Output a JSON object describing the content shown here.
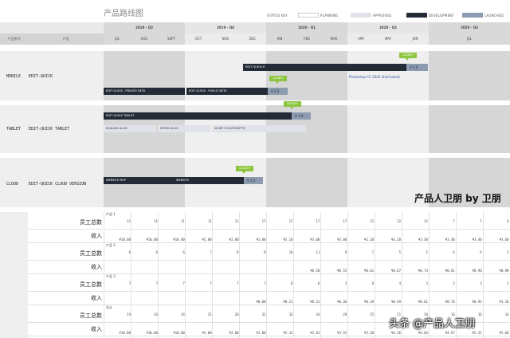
{
  "title": "产品路线图",
  "status_key": {
    "label": "STATUS KEY",
    "items": [
      {
        "label": "PLANNING",
        "color": "#ffffff"
      },
      {
        "label": "APPROVED",
        "color": "#dfe3e8"
      },
      {
        "label": "DEVELOPMENT",
        "color": "#232b36"
      },
      {
        "label": "LAUNCHED",
        "color": "#8c9bb0"
      }
    ]
  },
  "header": {
    "col1": "产品系列",
    "col2": "产品",
    "quarters": [
      "2019 - Q3",
      "2019 - Q4",
      "2020 - Q1",
      "2020 - Q2",
      "2020 - Q3"
    ],
    "months": [
      "JUL",
      "AUG",
      "SEPT",
      "OCT",
      "NOV",
      "DEC",
      "JAN",
      "FEB",
      "MAR",
      "APR",
      "MAY",
      "JUN",
      "JUL"
    ]
  },
  "lanes": [
    {
      "series": "MOBILE",
      "product": "EDIT-QUICK",
      "bars": [
        {
          "label": "EDIT QUICK 8"
        },
        {
          "label": "EDIT QUICK - PRIVATE BETA"
        },
        {
          "label": "EDIT QUICK - PUBLIC BETA"
        }
      ],
      "versions": [
        "V 3.0",
        "V 2.0"
      ],
      "launch": "LAUNCH",
      "note": "Photoshop CC 2020 (Estimated)"
    },
    {
      "series": "TABLET",
      "product": "EDIT-QUICK TABLET",
      "bars": [
        {
          "label": "EDIT QUICK TABLET"
        },
        {
          "label": "SCALING ALGO"
        },
        {
          "label": "SPEED ALGO"
        },
        {
          "label": "16 BIT COLOR DEPTH"
        }
      ],
      "versions": [
        "V 1.0"
      ],
      "launch": "LAUNCH"
    },
    {
      "series": "CLOUD",
      "product": "EDIT-QUICK CLOUD VERSION",
      "bars": [
        {
          "label": "WEBSITE MVP"
        },
        {
          "label": "WEBSITE"
        }
      ],
      "versions": [
        "V 1.0"
      ],
      "launch": "LAUNCH"
    }
  ],
  "watermark_top": "产品人卫朋 by 卫朋",
  "watermark_bottom": "头条 @产品人卫朋",
  "table": {
    "groups": [
      {
        "name": "产品 1",
        "rows": [
          {
            "label": "员工总数",
            "values": [
              "11",
              "11",
              "11",
              "11",
              "11",
              "17",
              "17",
              "17",
              "17",
              "12",
              "12",
              "12",
              "7",
              "7",
              "6"
            ]
          },
          {
            "label": "收入",
            "values": [
              "¥10.00",
              "¥10.00",
              "¥10.00",
              "¥2.00",
              "¥2.00",
              "¥1.00",
              "¥2.10",
              "¥3.00",
              "¥3.00",
              "¥2.20",
              "¥3.20",
              "¥3.30",
              "¥3.40",
              "¥3.40",
              "¥3.60"
            ]
          }
        ]
      },
      {
        "name": "产品 2",
        "rows": [
          {
            "label": "员工总数",
            "values": [
              "6",
              "6",
              "6",
              "7",
              "8",
              "8",
              "10",
              "11",
              "9",
              "7",
              "5",
              "5",
              "6",
              "6",
              "5"
            ]
          },
          {
            "label": "收入",
            "values": [
              "",
              "",
              "",
              "",
              "",
              "",
              "",
              "¥0.50",
              "¥0.55",
              "¥0.61",
              "¥0.67",
              "¥0.73",
              "¥0.81",
              "¥0.90",
              "¥0.98"
            ]
          }
        ]
      },
      {
        "name": "产品 3",
        "rows": [
          {
            "label": "员工总数",
            "values": [
              "7",
              "7",
              "7",
              "7",
              "7",
              "7",
              "6",
              "6",
              "3",
              "6",
              "4",
              "3",
              "3",
              "3",
              "3"
            ]
          },
          {
            "label": "收入",
            "values": [
              "",
              "",
              "",
              "",
              "",
              "¥0.00",
              "¥0.21",
              "¥0.31",
              "¥0.36",
              "¥0.39",
              "¥0.49",
              "¥0.61",
              "¥0.76",
              "¥0.95",
              "¥1.10"
            ]
          }
        ]
      },
      {
        "name": "总计",
        "rows": [
          {
            "label": "员工总数",
            "values": [
              "24",
              "24",
              "24",
              "25",
              "26",
              "32",
              "33",
              "34",
              "29",
              "25",
              "21",
              "20",
              "16",
              "16",
              "14"
            ]
          },
          {
            "label": "收入",
            "values": [
              "¥10.00",
              "¥10.00",
              "¥10.00",
              "¥2.00",
              "¥2.00",
              "¥1.00",
              "¥2.31",
              "¥3.81",
              "¥3.91",
              "¥3.20",
              "¥4.36",
              "¥4.64",
              "¥4.97",
              "¥5.25",
              "¥5.68"
            ]
          }
        ]
      }
    ]
  }
}
